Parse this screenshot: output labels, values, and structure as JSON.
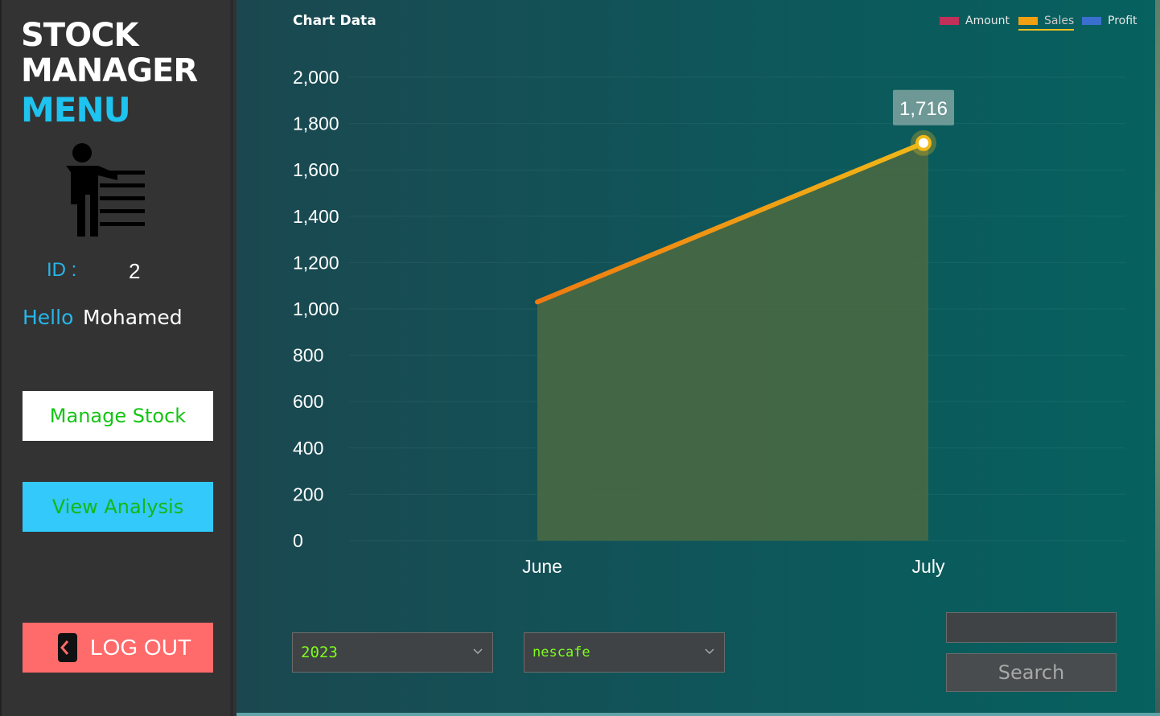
{
  "sidebar": {
    "brand_line1": "STOCK",
    "brand_line2": "MANAGER",
    "brand_line3": "MENU",
    "id_label": "ID :",
    "id_value": "2",
    "hello_label": "Hello",
    "user_name": "Mohamed",
    "manage_label": "Manage Stock",
    "analysis_label": "View Analysis",
    "logout_label": "LOG OUT",
    "user_icon": "person-list-icon",
    "logout_icon": "logout-door-icon"
  },
  "main": {
    "chart_title": "Chart Data",
    "legend": [
      {
        "label": "Amount",
        "color": "#c0305a"
      },
      {
        "label": "Sales",
        "color": "#f0a010"
      },
      {
        "label": "Profit",
        "color": "#3a6fd0"
      }
    ],
    "year_select": "2023",
    "product_select": "nescafe",
    "search_placeholder": "",
    "search_label": "Search"
  },
  "chart_data": {
    "type": "area",
    "title": "Chart Data",
    "categories": [
      "June",
      "July"
    ],
    "series": [
      {
        "name": "Sales",
        "values": [
          1030,
          1716
        ],
        "color": "#f0a010"
      }
    ],
    "ylim": [
      0,
      2000
    ],
    "yticks": [
      "0",
      "200",
      "400",
      "600",
      "800",
      "1,000",
      "1,200",
      "1,400",
      "1,600",
      "1,800",
      "2,000"
    ],
    "tooltip": "1,716",
    "grid": true,
    "legend_position": "top-right"
  }
}
